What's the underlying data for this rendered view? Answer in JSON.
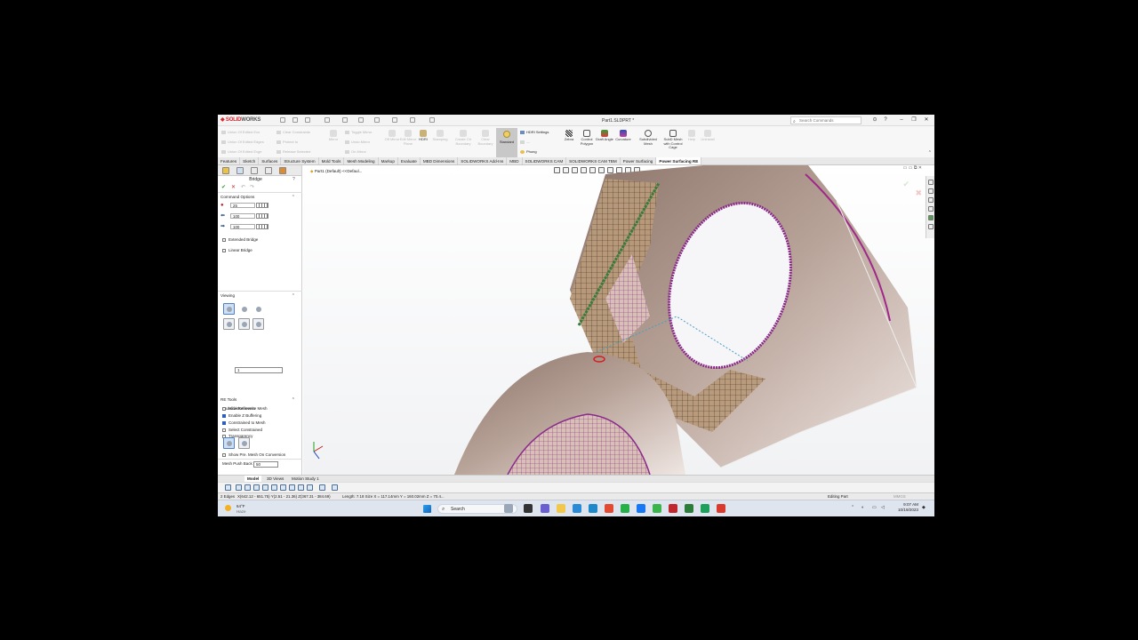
{
  "titlebar": {
    "logo_main": "SOLID",
    "logo_sub": "WORKS",
    "document_title": "Part1.SLDPRT *",
    "search_placeholder": "Search Commands",
    "min": "–",
    "max": "❐",
    "close": "✕",
    "help_icons": [
      "⌕",
      "?",
      "⊙"
    ]
  },
  "ribbon": {
    "small_commands": [
      "Union Of Edited Exo",
      "Union Of Edited Edges",
      "Union Of Edited Exge",
      "Clear Constraints",
      "Protect to",
      "Release Selected",
      "Toggle Mirror",
      "Undo Mirror",
      "On Mirror"
    ],
    "big_commands": [
      {
        "label": "Mirror",
        "dim": true
      },
      {
        "label": "Off Mirror",
        "dim": true
      },
      {
        "label": "Edit Mirror Plane",
        "dim": true
      },
      {
        "label": "HDRI",
        "dim": false
      },
      {
        "label": "Stamping",
        "dim": true
      },
      {
        "label": "Create Ctr Boundary",
        "dim": true
      },
      {
        "label": "Clear Boundary",
        "dim": true
      }
    ],
    "standard_label": "Standard",
    "hdri_settings": "HDRI Settings",
    "phong": "Phong",
    "display_commands": [
      {
        "label": "Zebra",
        "dim": false
      },
      {
        "label": "Control Polygon",
        "dim": false
      },
      {
        "label": "Draft Angle",
        "dim": false
      },
      {
        "label": "Curvature",
        "dim": false
      },
      {
        "label": "Subdivided Mesh",
        "dim": false
      },
      {
        "label": "SubD Mesh with Control Cage",
        "dim": false
      },
      {
        "label": "Help",
        "dim": true
      },
      {
        "label": "Uninstall",
        "dim": true
      }
    ]
  },
  "tabs": [
    "Features",
    "Sketch",
    "Surfaces",
    "Structure System",
    "Mold Tools",
    "Mesh Modeling",
    "Markup",
    "Evaluate",
    "MBD Dimensions",
    "SOLIDWORKS Add-Ins",
    "MBD",
    "SOLIDWORKS CAM",
    "SOLIDWORKS CAM TBM",
    "Power Surfacing",
    "Power Surfacing RE"
  ],
  "active_tab": "Power Surfacing RE",
  "property_manager": {
    "title": "Bridge",
    "ok": "✔",
    "cancel": "✕",
    "command_options": {
      "header": "Command Options",
      "values": [
        "25",
        "100",
        "100"
      ]
    },
    "extended_bridge": "Extended Bridge",
    "linear_bridge": "Linear Bridge",
    "viewing": {
      "header": "Viewing",
      "subdivision_label": "Subdivision levels",
      "subdivision_value": "1",
      "transparency": "Transparency"
    },
    "re_tools": {
      "header": "RE Tools",
      "options": [
        {
          "label": "Hide Reference Mesh",
          "checked": false
        },
        {
          "label": "Enable Z Buffering",
          "checked": true
        },
        {
          "label": "Constrained to Mesh",
          "checked": true
        },
        {
          "label": "Select Constrained",
          "checked": false
        }
      ],
      "show_pre_mesh": "Show Pre. Mesh On Conversion",
      "push_back_label": "Mesh Push Back",
      "push_back_value": "50"
    }
  },
  "viewport": {
    "tree_label": "Part1 (Default) <<Defaul..."
  },
  "model_tabs": [
    "Model",
    "3D Views",
    "Motion Study 1"
  ],
  "active_model_tab": "Model",
  "status": {
    "edges": "2 Edges",
    "coords": "X(642.12 - 651.75) Y(2.51 - 21.36) Z(367.31 - 384.69)",
    "length": "Length: 7.18 Size X = 117.14mm Y = 160.02mm Z = 70.4...",
    "mode": "Editing Part",
    "units": "MMGS"
  },
  "taskbar": {
    "weather_temp": "64°F",
    "weather_desc": "Haze",
    "search": "Search",
    "time": "9:07 AM",
    "date": "10/19/2023"
  }
}
